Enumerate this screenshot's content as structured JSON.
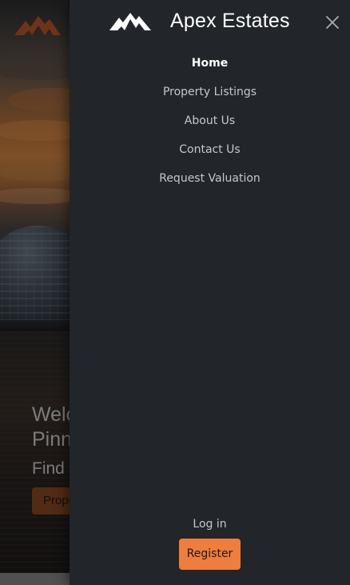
{
  "brand": {
    "name": "Apex Estates",
    "logo_icon": "mountain-peaks-icon",
    "accent_color": "#ef7d3c"
  },
  "drawer": {
    "close_icon": "close-icon",
    "nav_items": [
      {
        "label": "Home",
        "active": true
      },
      {
        "label": "Property Listings",
        "active": false
      },
      {
        "label": "About Us",
        "active": false
      },
      {
        "label": "Contact Us",
        "active": false
      },
      {
        "label": "Request Valuation",
        "active": false
      }
    ],
    "login_label": "Log in",
    "register_label": "Register"
  },
  "hero": {
    "title_visible": "Welc\nPinn",
    "subtitle_visible": "Find",
    "cta_visible": "Prope"
  }
}
